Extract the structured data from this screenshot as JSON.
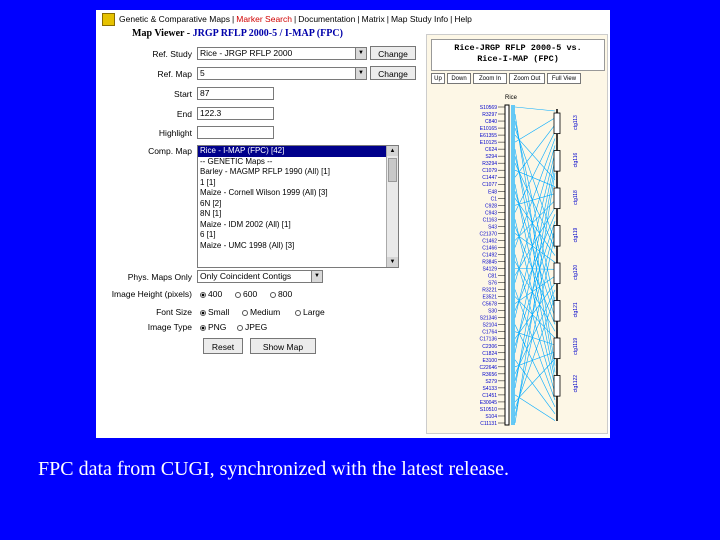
{
  "nav": {
    "items": [
      "Genetic & Comparative Maps",
      "Marker Search",
      "Documentation",
      "Matrix",
      "Map Study Info",
      "Help"
    ],
    "current_index": 1
  },
  "title": {
    "main": "Map Viewer - ",
    "sub": "JRGP RFLP 2000-5 / I-MAP (FPC)"
  },
  "form": {
    "ref_study": {
      "label": "Ref. Study",
      "value": "Rice - JRGP RFLP 2000"
    },
    "ref_map": {
      "label": "Ref. Map",
      "value": "5"
    },
    "start": {
      "label": "Start",
      "value": "87"
    },
    "end": {
      "label": "End",
      "value": "122.3"
    },
    "highlight": {
      "label": "Highlight",
      "value": ""
    },
    "comp_map": {
      "label": "Comp. Map",
      "options": [
        "Rice - I-MAP (FPC) [42]",
        "-- GENETIC Maps --",
        "Barley - MAGMP RFLP 1990 (All) [1]",
        "1 [1]",
        "Maize - Cornell Wilson 1999 (All) [3]",
        "6N [2]",
        "8N [1]",
        "Maize - IDM 2002 (All) [1]",
        "6 [1]",
        "Maize - UMC 1998 (All) [3]"
      ],
      "selected_index": 0
    },
    "phys_maps": {
      "label": "Phys. Maps Only",
      "value": "Only Coincident Contigs"
    },
    "image_height": {
      "label": "Image Height (pixels)",
      "options": [
        "400",
        "600",
        "800"
      ],
      "selected": 0
    },
    "font_size": {
      "label": "Font Size",
      "options": [
        "Small",
        "Medium",
        "Large"
      ],
      "selected": 0
    },
    "image_type": {
      "label": "Image Type",
      "options": [
        "PNG",
        "JPEG"
      ],
      "selected": 0
    },
    "change_label": "Change",
    "reset_label": "Reset",
    "show_map_label": "Show Map"
  },
  "map_panel": {
    "header1": "Rice-JRGP RFLP 2000-5 vs.",
    "header2": "Rice-I-MAP (FPC)",
    "buttons": [
      "Up",
      "Down",
      "Zoom In",
      "Zoom Out",
      "Full View"
    ],
    "ref_label": "Rice",
    "markers": [
      "S10569",
      "R3297",
      "C840",
      "E10165",
      "E61355",
      "E10125",
      "C624",
      "S294",
      "R3294",
      "C1079",
      "C1447",
      "C1077",
      "E48",
      "C1",
      "C928",
      "C943",
      "C1163",
      "S43",
      "C21370",
      "C1462",
      "C1466",
      "C1492",
      "R3845",
      "S4129",
      "C81",
      "S76",
      "R3221",
      "E3521",
      "C5678",
      "S30",
      "S21346",
      "S2104",
      "C1764",
      "C17136",
      "C2306",
      "C1824",
      "E3100",
      "C22646",
      "R3656",
      "S279",
      "S4133",
      "C1451",
      "E30045",
      "S10510",
      "S104",
      "C11131"
    ],
    "contigs": [
      "ctg113",
      "ctg116",
      "ctg118",
      "ctg119",
      "ctg120",
      "ctg121",
      "ctg1119",
      "ctg1122"
    ],
    "highlight_color": "#00aaff"
  },
  "caption": "FPC data from CUGI, synchronized with the latest release.",
  "colors": {
    "background": "#0000ff",
    "nav_current": "#d00000",
    "title_sub": "#0000aa",
    "list_selected": "#00008b"
  }
}
